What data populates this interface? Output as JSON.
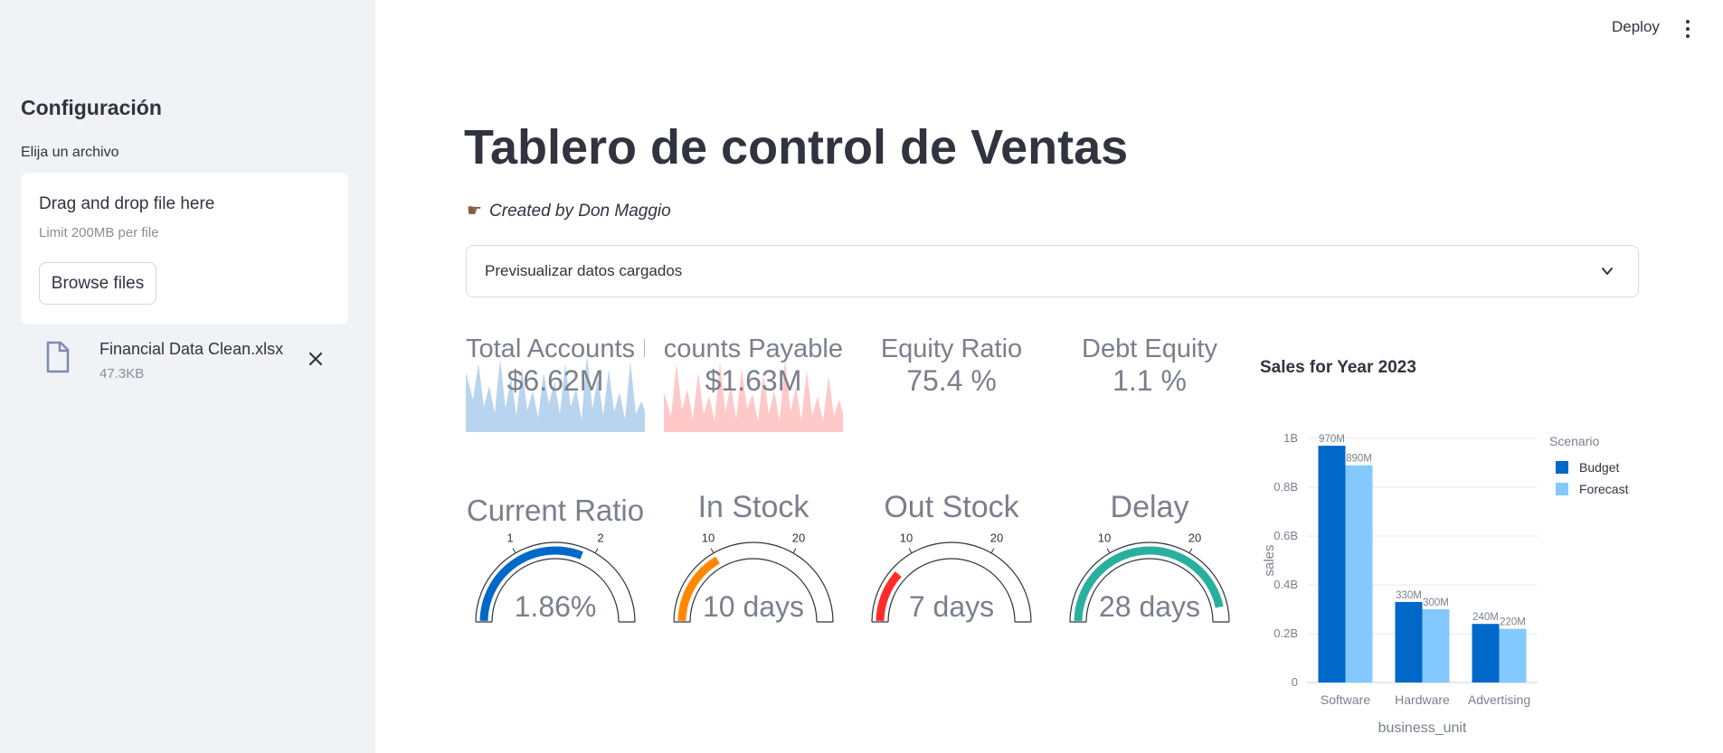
{
  "sidebar": {
    "title": "Configuración",
    "uploader_label": "Elija un archivo",
    "dropzone_title": "Drag and drop file here",
    "dropzone_limit": "Limit 200MB per file",
    "browse_label": "Browse files",
    "file_name": "Financial Data Clean.xlsx",
    "file_size": "47.3KB"
  },
  "header": {
    "deploy_label": "Deploy"
  },
  "main": {
    "title": "Tablero de control de Ventas",
    "caption": "Created by Don Maggio",
    "expander_label": "Previsualizar datos cargados"
  },
  "metrics": [
    {
      "title": "Total Accounts Receivable",
      "value": "$6.62M",
      "spark_color": "#b9d4ef"
    },
    {
      "title": "Total Accounts Payable",
      "value": "$1.63M",
      "spark_color": "#ffc9c9"
    },
    {
      "title": "Equity Ratio",
      "value": "75.4 %"
    },
    {
      "title": "Debt Equity",
      "value": "1.1 %"
    }
  ],
  "gauges": [
    {
      "title": "Current Ratio",
      "value_text": "1.86%",
      "value": 1.86,
      "max": 3,
      "ticks": [
        "1",
        "2"
      ],
      "color": "#0068c9"
    },
    {
      "title": "In Stock",
      "value_text": "10 days",
      "value": 10,
      "max": 30,
      "ticks": [
        "10",
        "20"
      ],
      "color": "#ff8700"
    },
    {
      "title": "Out Stock",
      "value_text": "7 days",
      "value": 7,
      "max": 30,
      "ticks": [
        "10",
        "20"
      ],
      "color": "#ff2b2b"
    },
    {
      "title": "Delay",
      "value_text": "28 days",
      "value": 28,
      "max": 30,
      "ticks": [
        "10",
        "20"
      ],
      "color": "#29b09d"
    }
  ],
  "chart_data": {
    "type": "bar",
    "title": "Sales for Year 2023",
    "xlabel": "business_unit",
    "ylabel": "sales",
    "categories": [
      "Software",
      "Hardware",
      "Advertising"
    ],
    "series": [
      {
        "name": "Budget",
        "values": [
          970000000,
          330000000,
          240000000
        ],
        "labels": [
          "970M",
          "330M",
          "240M"
        ],
        "color": "#0068c9"
      },
      {
        "name": "Forecast",
        "values": [
          890000000,
          300000000,
          220000000
        ],
        "labels": [
          "890M",
          "300M",
          "220M"
        ],
        "color": "#83c9ff"
      }
    ],
    "ylim": [
      0,
      1000000000
    ],
    "yticks": [
      "0",
      "0.2B",
      "0.4B",
      "0.6B",
      "0.8B",
      "1B"
    ],
    "legend_title": "Scenario",
    "legend_position": "right",
    "grid": true
  }
}
